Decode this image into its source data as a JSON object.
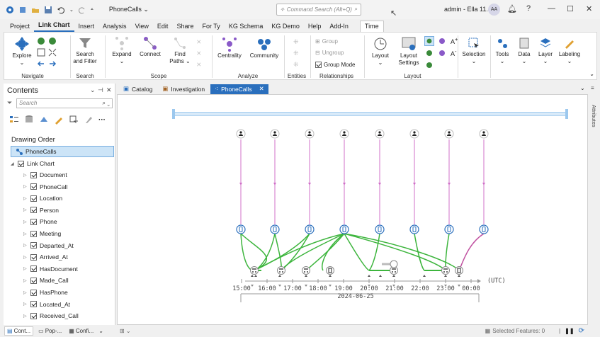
{
  "titlebar": {
    "doc_title": "PhoneCalls",
    "search_placeholder": "Command Search (Alt+Q)",
    "user": "admin - Ella 11.4",
    "avatar": "AA",
    "help": "?"
  },
  "tabs": [
    "Project",
    "Link Chart",
    "Insert",
    "Analysis",
    "View",
    "Edit",
    "Share",
    "For Ty",
    "KG Schema",
    "KG Demo",
    "Help",
    "Add-In",
    "Time"
  ],
  "ribbon": {
    "navigate": {
      "explore": "Explore",
      "label": "Navigate"
    },
    "search": {
      "search_filter_1": "Search",
      "search_filter_2": "and Filter",
      "label": "Search"
    },
    "scope": {
      "expand": "Expand",
      "connect": "Connect",
      "find_paths_1": "Find",
      "find_paths_2": "Paths",
      "label": "Scope"
    },
    "analyze": {
      "centrality": "Centrality",
      "community": "Community",
      "label": "Analyze"
    },
    "entities": {
      "label": "Entities"
    },
    "relationships": {
      "group": "Group",
      "ungroup": "Ungroup",
      "group_mode": "Group Mode",
      "label": "Relationships"
    },
    "layout": {
      "layout": "Layout",
      "layout_settings_1": "Layout",
      "layout_settings_2": "Settings",
      "label": "Layout"
    },
    "right": {
      "selection": "Selection",
      "tools": "Tools",
      "data": "Data",
      "layer": "Layer",
      "labeling": "Labeling"
    }
  },
  "contents": {
    "title": "Contents",
    "search_placeholder": "Search",
    "drawing_order": "Drawing Order",
    "root": "PhoneCalls",
    "group": "Link Chart",
    "layers": [
      "Document",
      "PhoneCall",
      "Location",
      "Person",
      "Phone",
      "Meeting",
      "Departed_At",
      "Arrived_At",
      "HasDocument",
      "Made_Call",
      "HasPhone",
      "Located_At",
      "Received_Call"
    ]
  },
  "bottom_tabs": [
    "Cont...",
    "Pop-...",
    "Confi..."
  ],
  "doc_tabs": [
    "Catalog",
    "Investigation",
    "PhoneCalls"
  ],
  "timeline": {
    "ticks": [
      "15:00",
      "16:00",
      "17:00",
      "18:00",
      "19:00",
      "20:00",
      "21:00",
      "22:00",
      "23:00",
      "00:00"
    ],
    "utc": "(UTC)",
    "date": "2024-06-25"
  },
  "status": {
    "selected_features": "Selected Features: 0"
  },
  "side": {
    "attributes": "Attributes"
  },
  "colors": {
    "accent": "#2a6fbd",
    "link_green": "#3db53d",
    "link_magenta": "#c050a0",
    "made_call": "#d070c8"
  }
}
